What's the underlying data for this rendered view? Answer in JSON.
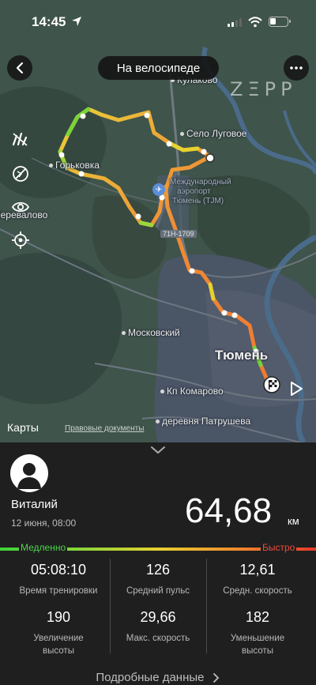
{
  "status_bar": {
    "time": "14:45"
  },
  "header": {
    "activity_title": "На велосипеде",
    "brand": "ZΞPP"
  },
  "map": {
    "labels": {
      "kulakovo": "Кулаково",
      "selo_lugovoe": "Село Луговое",
      "gorkovka": "Горьковка",
      "airport": "Международный аэропорт Тюмень (TJM)",
      "airport_l1": "Международный",
      "airport_l2": "аэропорт",
      "airport_l3": "Тюмень (TJM)",
      "road": "71Н-1709",
      "perevalovo": "Перевалово",
      "moskovsky": "Московский",
      "tyumen": "Тюмень",
      "komarovo": "Кп Комарово",
      "patrusheva": "деревня Патрушева"
    },
    "attribution": "Карты",
    "legal": "Правовые документы"
  },
  "user": {
    "name": "Виталий",
    "date": "12 июня, 08:00"
  },
  "summary": {
    "distance": "64,68",
    "unit": "км"
  },
  "speed_legend": {
    "slow": "Медленно",
    "fast": "Быстро"
  },
  "stats": [
    {
      "value": "05:08:10",
      "label": "Время тренировки"
    },
    {
      "value": "126",
      "label": "Средний пульс"
    },
    {
      "value": "12,61",
      "label": "Средн. скорость"
    },
    {
      "value": "190",
      "label": "Увеличение высоты"
    },
    {
      "value": "29,66",
      "label": "Макс. скорость"
    },
    {
      "value": "182",
      "label": "Уменьшение высоты"
    }
  ],
  "details_link": "Подробные данные",
  "colors": {
    "slow": "#3fd23a",
    "mid": "#e6d12f",
    "fast": "#e8392a",
    "route": "#f07a30"
  }
}
